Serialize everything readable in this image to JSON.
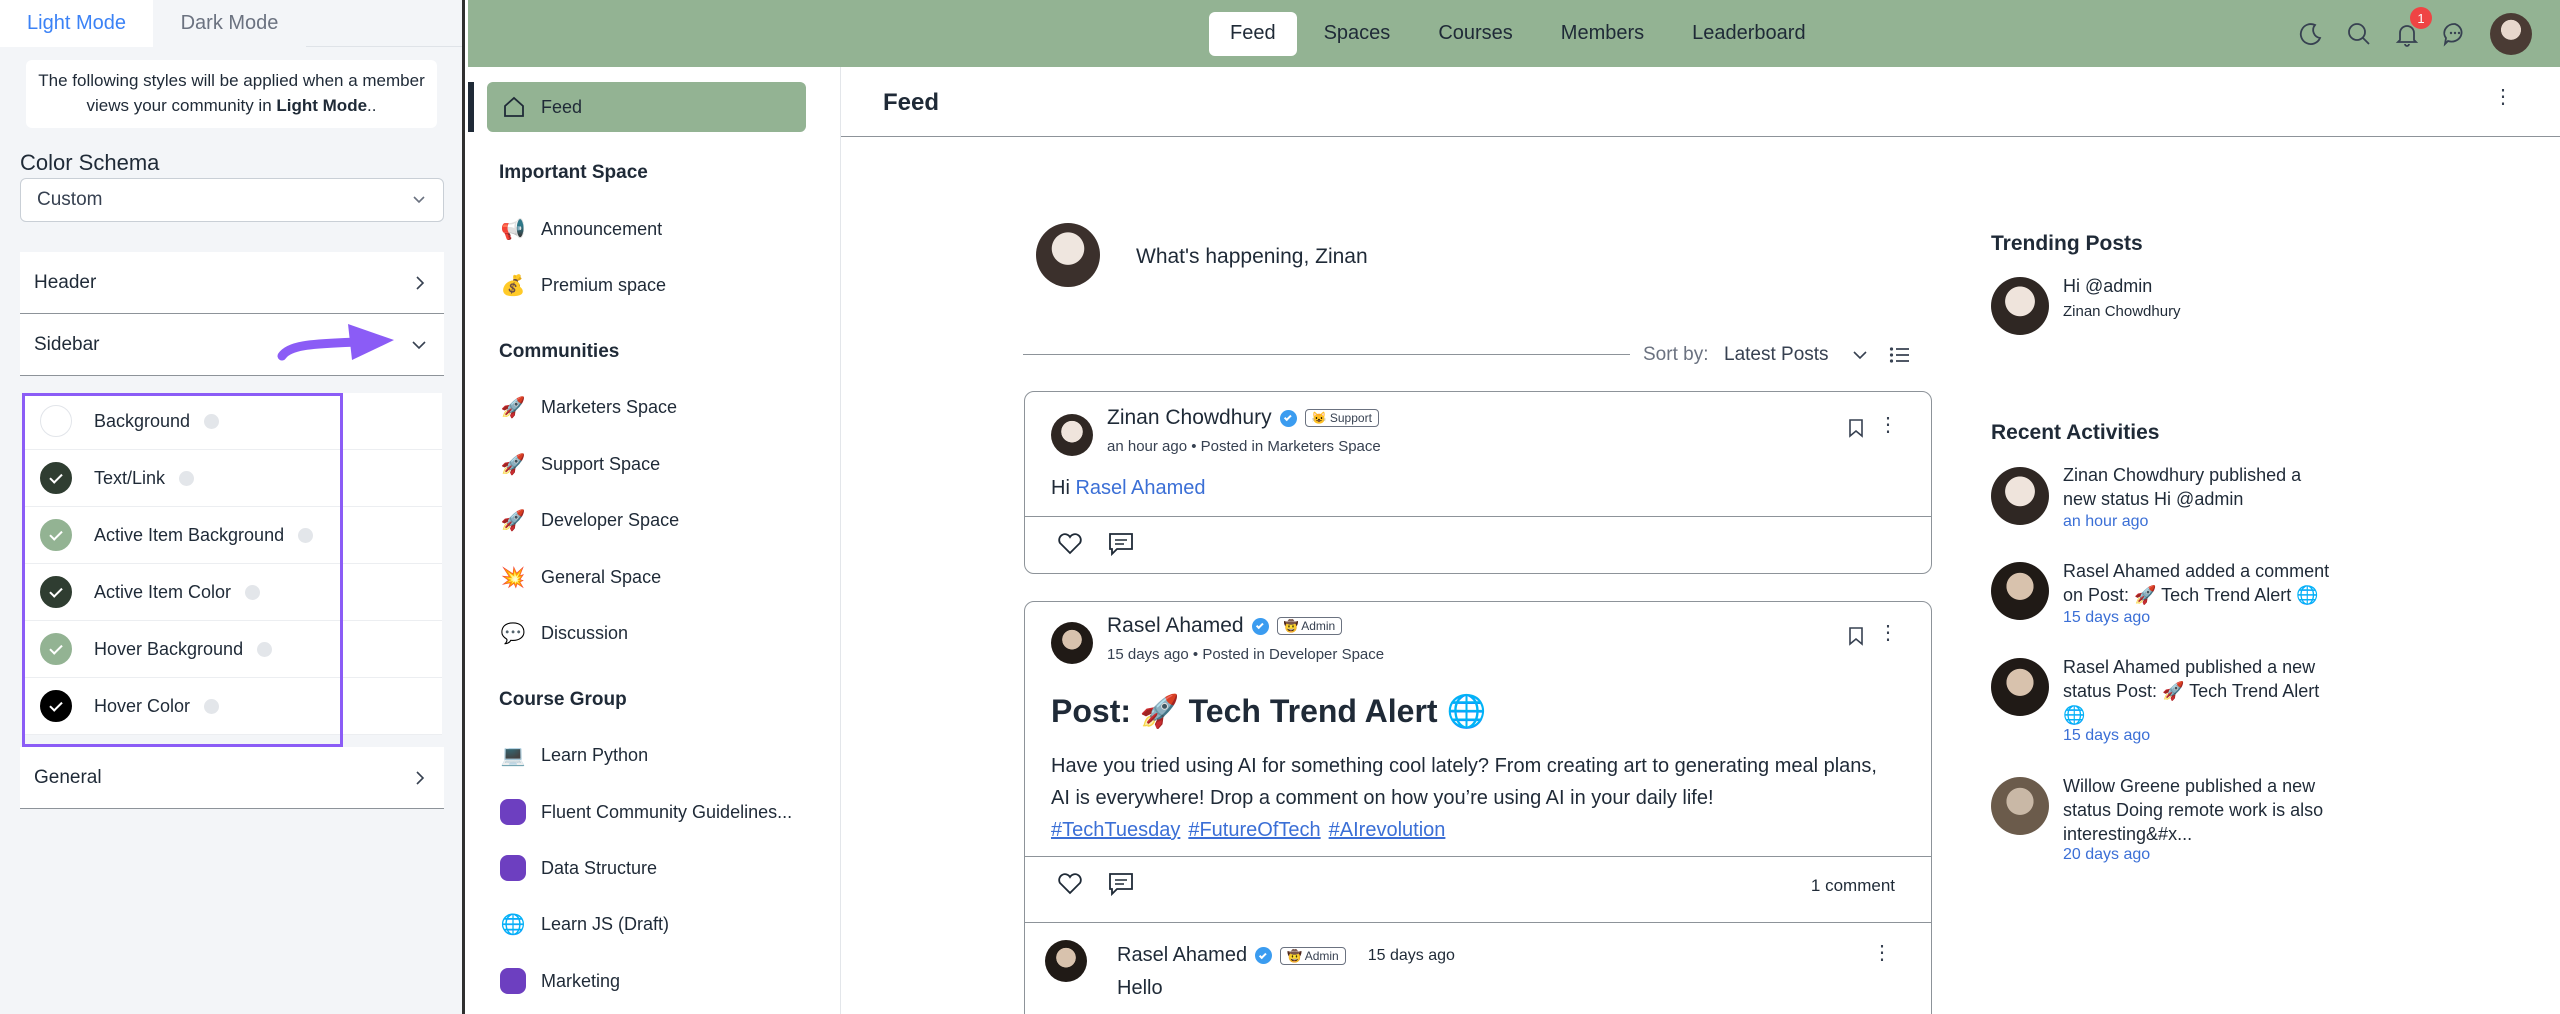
{
  "customizer": {
    "tabs": [
      "Light Mode",
      "Dark Mode"
    ],
    "info_prefix": "The following styles will be applied when a member views your community in ",
    "info_mode": "Light Mode",
    "info_suffix": "..",
    "color_schema_label": "Color Schema",
    "color_schema_value": "Custom",
    "sections": {
      "header": "Header",
      "sidebar": "Sidebar",
      "general": "General"
    },
    "sidebar_options": [
      {
        "label": "Background",
        "color": "#ffffff"
      },
      {
        "label": "Text/Link",
        "color": "#2f3d31"
      },
      {
        "label": "Active Item Background",
        "color": "#93b393"
      },
      {
        "label": "Active Item Color",
        "color": "#2f3d31"
      },
      {
        "label": "Hover Background",
        "color": "#93b393"
      },
      {
        "label": "Hover Color",
        "color": "#000000"
      }
    ]
  },
  "topbar": {
    "nav": [
      "Feed",
      "Spaces",
      "Courses",
      "Members",
      "Leaderboard"
    ],
    "active": "Feed",
    "notification_count": "1",
    "bg_color": "#93b393"
  },
  "sidebar": {
    "feed_label": "Feed",
    "groups": [
      {
        "title": "Important Space",
        "items": [
          {
            "label": "Announcement",
            "icon": "megaphone-icon"
          },
          {
            "label": "Premium space",
            "icon": "money-bag-icon"
          }
        ]
      },
      {
        "title": "Communities",
        "items": [
          {
            "label": "Marketers Space",
            "icon": "rocket-icon"
          },
          {
            "label": "Support Space",
            "icon": "rocket-icon"
          },
          {
            "label": "Developer Space",
            "icon": "rocket-icon"
          },
          {
            "label": "General Space",
            "icon": "collision-icon"
          },
          {
            "label": "Discussion",
            "icon": "speech-bubble-icon"
          }
        ]
      },
      {
        "title": "Course Group",
        "items": [
          {
            "label": "Learn Python",
            "icon": "laptop-icon"
          },
          {
            "label": "Fluent Community Guidelines...",
            "icon": "purple-square-icon"
          },
          {
            "label": "Data Structure",
            "icon": "purple-square-icon"
          },
          {
            "label": "Learn JS (Draft)",
            "icon": "globe-icon"
          },
          {
            "label": "Marketing",
            "icon": "purple-square-icon"
          }
        ]
      }
    ]
  },
  "main": {
    "title": "Feed",
    "composer_placeholder": "What's happening, Zinan",
    "sort_label": "Sort by:",
    "sort_value": "Latest Posts",
    "posts": [
      {
        "author": "Zinan Chowdhury",
        "role": "😺 Support",
        "meta": "an hour ago • Posted in Marketers Space",
        "text_prefix": "Hi ",
        "mention": "Rasel Ahamed"
      },
      {
        "author": "Rasel Ahamed",
        "role": "🤠 Admin",
        "meta": "15 days ago • Posted in Developer Space",
        "title": "Post: 🚀 Tech Trend Alert 🌐",
        "body": "Have you tried using AI for something cool lately? From creating art to generating meal plans, AI is everywhere! Drop a comment on how you’re using AI in your daily life!",
        "hashtags": [
          "#TechTuesday",
          "#FutureOfTech",
          "#AIrevolution"
        ],
        "comment_count": "1 comment",
        "comment": {
          "author": "Rasel Ahamed",
          "role": "🤠 Admin",
          "time": "15 days ago",
          "text": "Hello"
        }
      }
    ]
  },
  "right": {
    "trending_title": "Trending Posts",
    "trending": {
      "text": "Hi @admin",
      "author": "Zinan Chowdhury"
    },
    "recent_title": "Recent Activities",
    "activities": [
      {
        "lines": [
          "Zinan Chowdhury published a",
          "new status Hi @admin"
        ],
        "time": "an hour ago"
      },
      {
        "lines": [
          "Rasel Ahamed added a comment",
          "on Post: 🚀 Tech Trend Alert 🌐"
        ],
        "time": "15 days ago"
      },
      {
        "lines": [
          "Rasel Ahamed published a new",
          "status Post: 🚀 Tech Trend Alert",
          "🌐"
        ],
        "time": "15 days ago"
      },
      {
        "lines": [
          "Willow Greene published a new",
          "status Doing remote work is also",
          "interesting&#x..."
        ],
        "time": "20 days ago"
      }
    ]
  }
}
